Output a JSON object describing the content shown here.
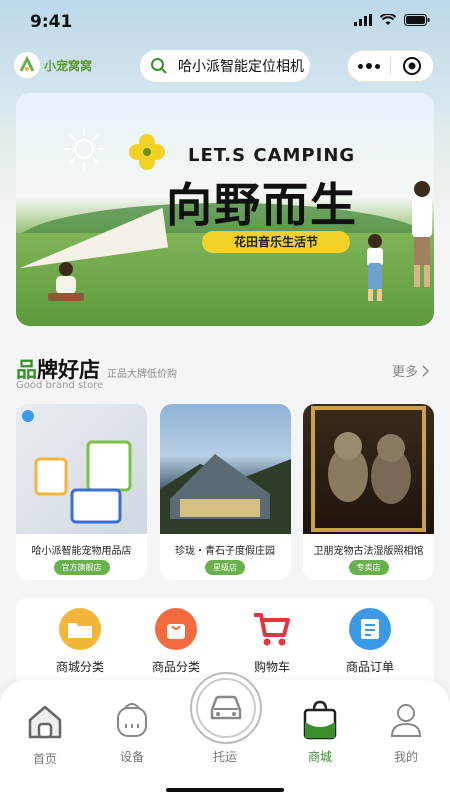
{
  "status": {
    "time": "9:41"
  },
  "header": {
    "logo_text": "小宠窝窝",
    "search_text": "哈小派智能定位相机"
  },
  "banner": {
    "lets_text": "LET.S CAMPING",
    "headline": "向野而生",
    "pill": "花田音乐生活节"
  },
  "brand": {
    "title_first": "品",
    "title_rest": "牌好店",
    "subtitle": "正品大牌低价购",
    "english": "Good brand store",
    "more": "更多"
  },
  "shops": [
    {
      "name": "哈小派智能宠物用品店",
      "tag": "官方旗舰店"
    },
    {
      "name": "珍珑・青石子度假庄园",
      "tag": "星级店"
    },
    {
      "name": "卫朋宠物古法湿版照相馆",
      "tag": "专卖店"
    }
  ],
  "categories": [
    {
      "label": "商城分类",
      "icon": "folder-icon",
      "color": "#f4b63a"
    },
    {
      "label": "商品分类",
      "icon": "shopping-bag-icon",
      "color": "#f36b3e"
    },
    {
      "label": "购物车",
      "icon": "cart-icon",
      "color": "#e7343f"
    },
    {
      "label": "商品订单",
      "icon": "order-icon",
      "color": "#3a9ae8"
    }
  ],
  "tabs": {
    "home": "首页",
    "device": "设备",
    "transport": "托运",
    "mall": "商城",
    "mine": "我的"
  },
  "colors": {
    "accent": "#3a8e2b",
    "tag": "#6ab04c"
  }
}
